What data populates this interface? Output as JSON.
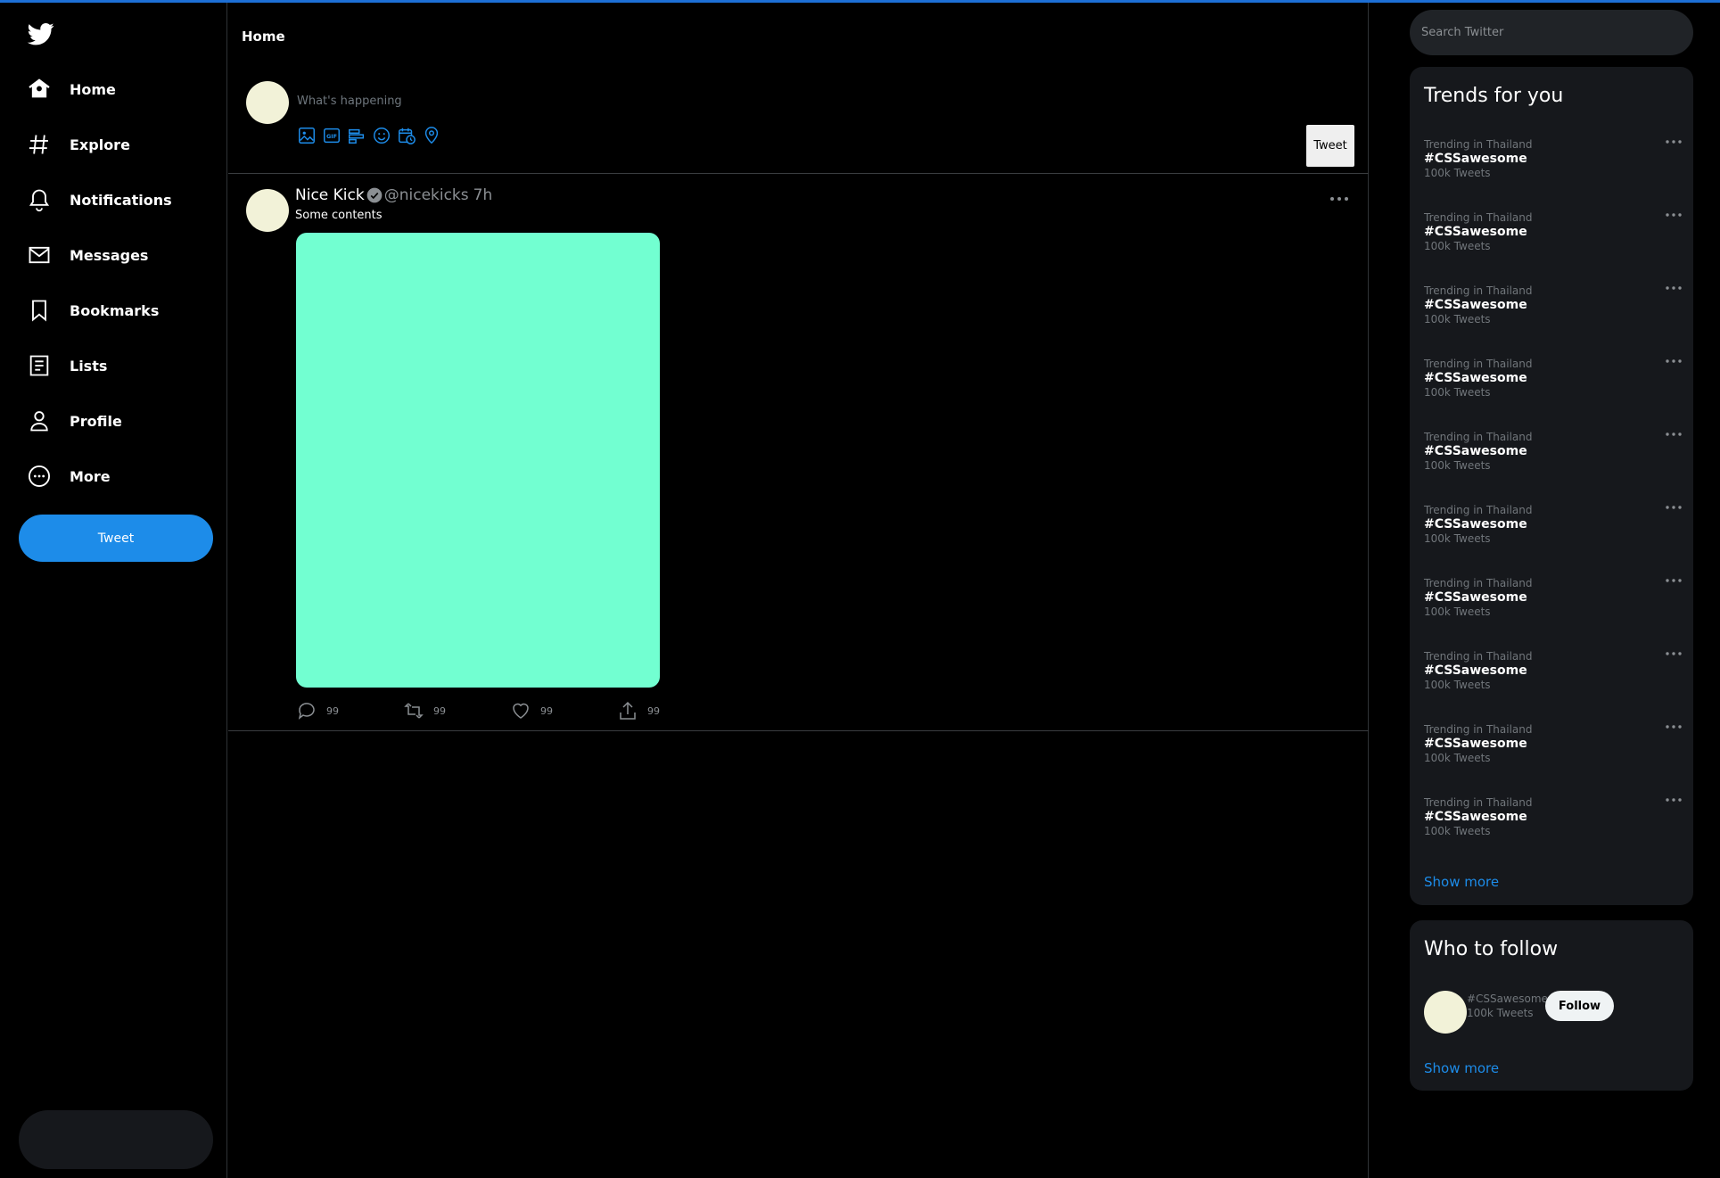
{
  "nav": {
    "items": [
      {
        "label": "Home",
        "icon": "home-icon"
      },
      {
        "label": "Explore",
        "icon": "hashtag-icon"
      },
      {
        "label": "Notifications",
        "icon": "bell-icon"
      },
      {
        "label": "Messages",
        "icon": "envelope-icon"
      },
      {
        "label": "Bookmarks",
        "icon": "bookmark-icon"
      },
      {
        "label": "Lists",
        "icon": "list-icon"
      },
      {
        "label": "Profile",
        "icon": "person-icon"
      },
      {
        "label": "More",
        "icon": "more-circle-icon"
      }
    ],
    "tweet_button": "Tweet"
  },
  "main": {
    "title": "Home",
    "compose": {
      "placeholder": "What's happening",
      "tweet_button": "Tweet",
      "icons": [
        "image-icon",
        "gif-icon",
        "poll-icon",
        "emoji-icon",
        "schedule-icon",
        "location-icon"
      ]
    },
    "post": {
      "name": "Nice Kick",
      "handle": "@nicekicks",
      "time": "7h",
      "text": "Some contents",
      "media_color": "#72ffd1",
      "replies": "99",
      "retweets": "99",
      "likes": "99",
      "shares": "99"
    }
  },
  "sidebar_right": {
    "search_placeholder": "Search Twitter",
    "trends_title": "Trends for you",
    "trends": [
      {
        "context": "Trending in Thailand",
        "tag": "#CSSawesome",
        "count": "100k Tweets"
      },
      {
        "context": "Trending in Thailand",
        "tag": "#CSSawesome",
        "count": "100k Tweets"
      },
      {
        "context": "Trending in Thailand",
        "tag": "#CSSawesome",
        "count": "100k Tweets"
      },
      {
        "context": "Trending in Thailand",
        "tag": "#CSSawesome",
        "count": "100k Tweets"
      },
      {
        "context": "Trending in Thailand",
        "tag": "#CSSawesome",
        "count": "100k Tweets"
      },
      {
        "context": "Trending in Thailand",
        "tag": "#CSSawesome",
        "count": "100k Tweets"
      },
      {
        "context": "Trending in Thailand",
        "tag": "#CSSawesome",
        "count": "100k Tweets"
      },
      {
        "context": "Trending in Thailand",
        "tag": "#CSSawesome",
        "count": "100k Tweets"
      },
      {
        "context": "Trending in Thailand",
        "tag": "#CSSawesome",
        "count": "100k Tweets"
      },
      {
        "context": "Trending in Thailand",
        "tag": "#CSSawesome",
        "count": "100k Tweets"
      }
    ],
    "trends_show_more": "Show more",
    "follow_title": "Who to follow",
    "follow": {
      "name": "#CSSawesome",
      "sub": "100k Tweets",
      "button": "Follow"
    },
    "follow_show_more": "Show more"
  },
  "colors": {
    "accent": "#1d8ce9",
    "background": "#000000",
    "panel": "#16181c"
  }
}
